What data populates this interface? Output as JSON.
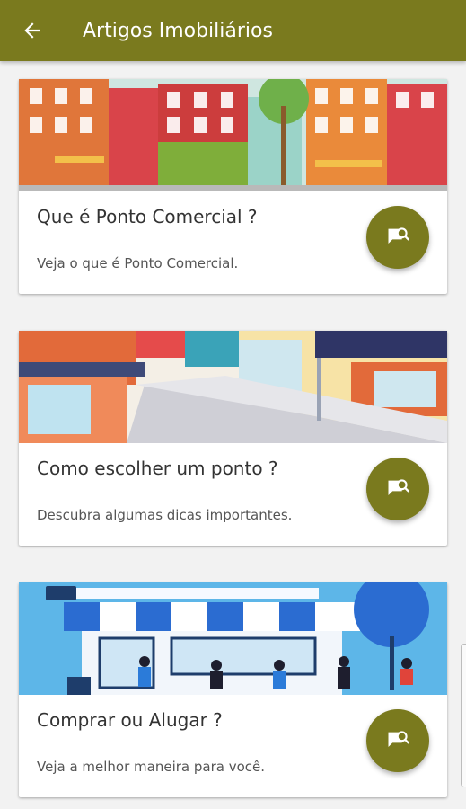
{
  "appbar": {
    "title": "Artigos Imobiliários"
  },
  "articles": [
    {
      "title": "Que é Ponto Comercial ?",
      "subtitle": "Veja o que é Ponto Comercial."
    },
    {
      "title": "Como escolher um ponto ?",
      "subtitle": "Descubra algumas dicas importantes."
    },
    {
      "title": "Comprar ou Alugar ?",
      "subtitle": "Veja a melhor maneira para você."
    }
  ],
  "icons": {
    "back": "arrow-left-icon",
    "article": "chat-search-icon"
  },
  "colors": {
    "primary": "#7a7a1e",
    "background": "#f2f2f2",
    "card": "#ffffff",
    "text": "#333333"
  }
}
